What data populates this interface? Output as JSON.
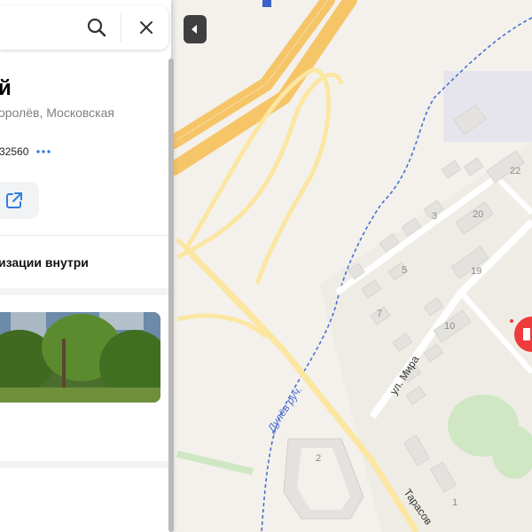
{
  "search": {
    "search_icon": "search-icon",
    "close_icon": "close-icon"
  },
  "place": {
    "title": "й",
    "address": "оролёв, Московская",
    "coordinates": "32560",
    "more_icon": "more-dots-icon",
    "share_icon": "external-link-icon",
    "organizations_inside": "изации внутри"
  },
  "map": {
    "street_mira": "ул. Мира",
    "stream_label": "Дулёв руч.",
    "street_tarasovskaya": "Тарасов",
    "house_numbers": [
      "22",
      "3",
      "20",
      "5",
      "19",
      "7",
      "10",
      "2",
      "1"
    ],
    "colors": {
      "highway": "#f5c568",
      "road": "#fbe6a2",
      "stream": "#4a6fd0",
      "park": "#cfe7c3",
      "annotation_arrow": "#e32727",
      "pin": "#ee3b3b"
    }
  },
  "ui": {
    "collapse_icon": "triangle-left-icon"
  }
}
